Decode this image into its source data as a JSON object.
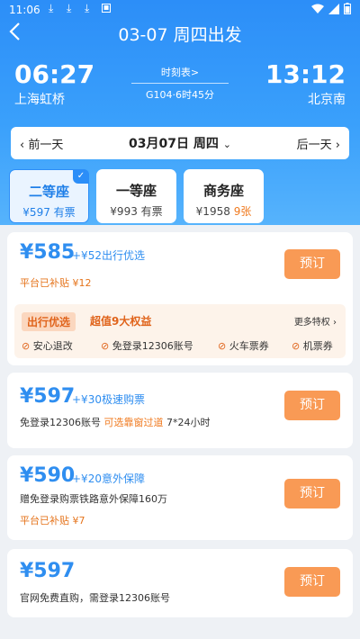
{
  "statusbar": {
    "time": "11:06",
    "download_icons": [
      "download-icon",
      "download-icon",
      "download-icon"
    ],
    "app_icon": "app-notification-icon"
  },
  "header": {
    "title": "03-07 周四出发",
    "back_icon": "back-chevron-icon"
  },
  "trip": {
    "dep_time": "06:27",
    "dep_station": "上海虹桥",
    "arr_time": "13:12",
    "arr_station": "北京南",
    "schedule_link": "时刻表>",
    "train_info": "G104·6时45分"
  },
  "datebar": {
    "prev": "前一天",
    "current": "03月07日 周四",
    "next": "后一天"
  },
  "seats": [
    {
      "name": "二等座",
      "price": "¥597",
      "status": "有票",
      "selected": true
    },
    {
      "name": "一等座",
      "price": "¥993",
      "status": "有票",
      "selected": false
    },
    {
      "name": "商务座",
      "price": "¥1958",
      "status": "9张",
      "selected": false
    }
  ],
  "offers": [
    {
      "price": "¥585",
      "extra": "+¥52出行优选",
      "subsidy": "平台已补贴 ¥12",
      "button": "预订",
      "benefits": {
        "tag": "出行优选",
        "title": "超值9大权益",
        "more": "更多特权",
        "items": [
          "安心退改",
          "免登录12306账号",
          "火车票券",
          "机票券"
        ]
      }
    },
    {
      "price": "¥597",
      "extra": "+¥30极速购票",
      "note_a": "免登录12306账号",
      "note_b": "可选靠窗过道",
      "note_c": "7*24小时",
      "button": "预订"
    },
    {
      "price": "¥590",
      "extra": "+¥20意外保障",
      "note": "赠免登录购票铁路意外保障160万",
      "subsidy": "平台已补贴 ¥7",
      "button": "预订"
    },
    {
      "price": "¥597",
      "note": "官网免费直购，需登录12306账号",
      "button": "预订"
    }
  ],
  "colors": {
    "brand_blue": "#2c8ef8",
    "price_blue": "#2f8ef0",
    "book_orange": "#f99a55",
    "accent_orange": "#e0641c"
  }
}
